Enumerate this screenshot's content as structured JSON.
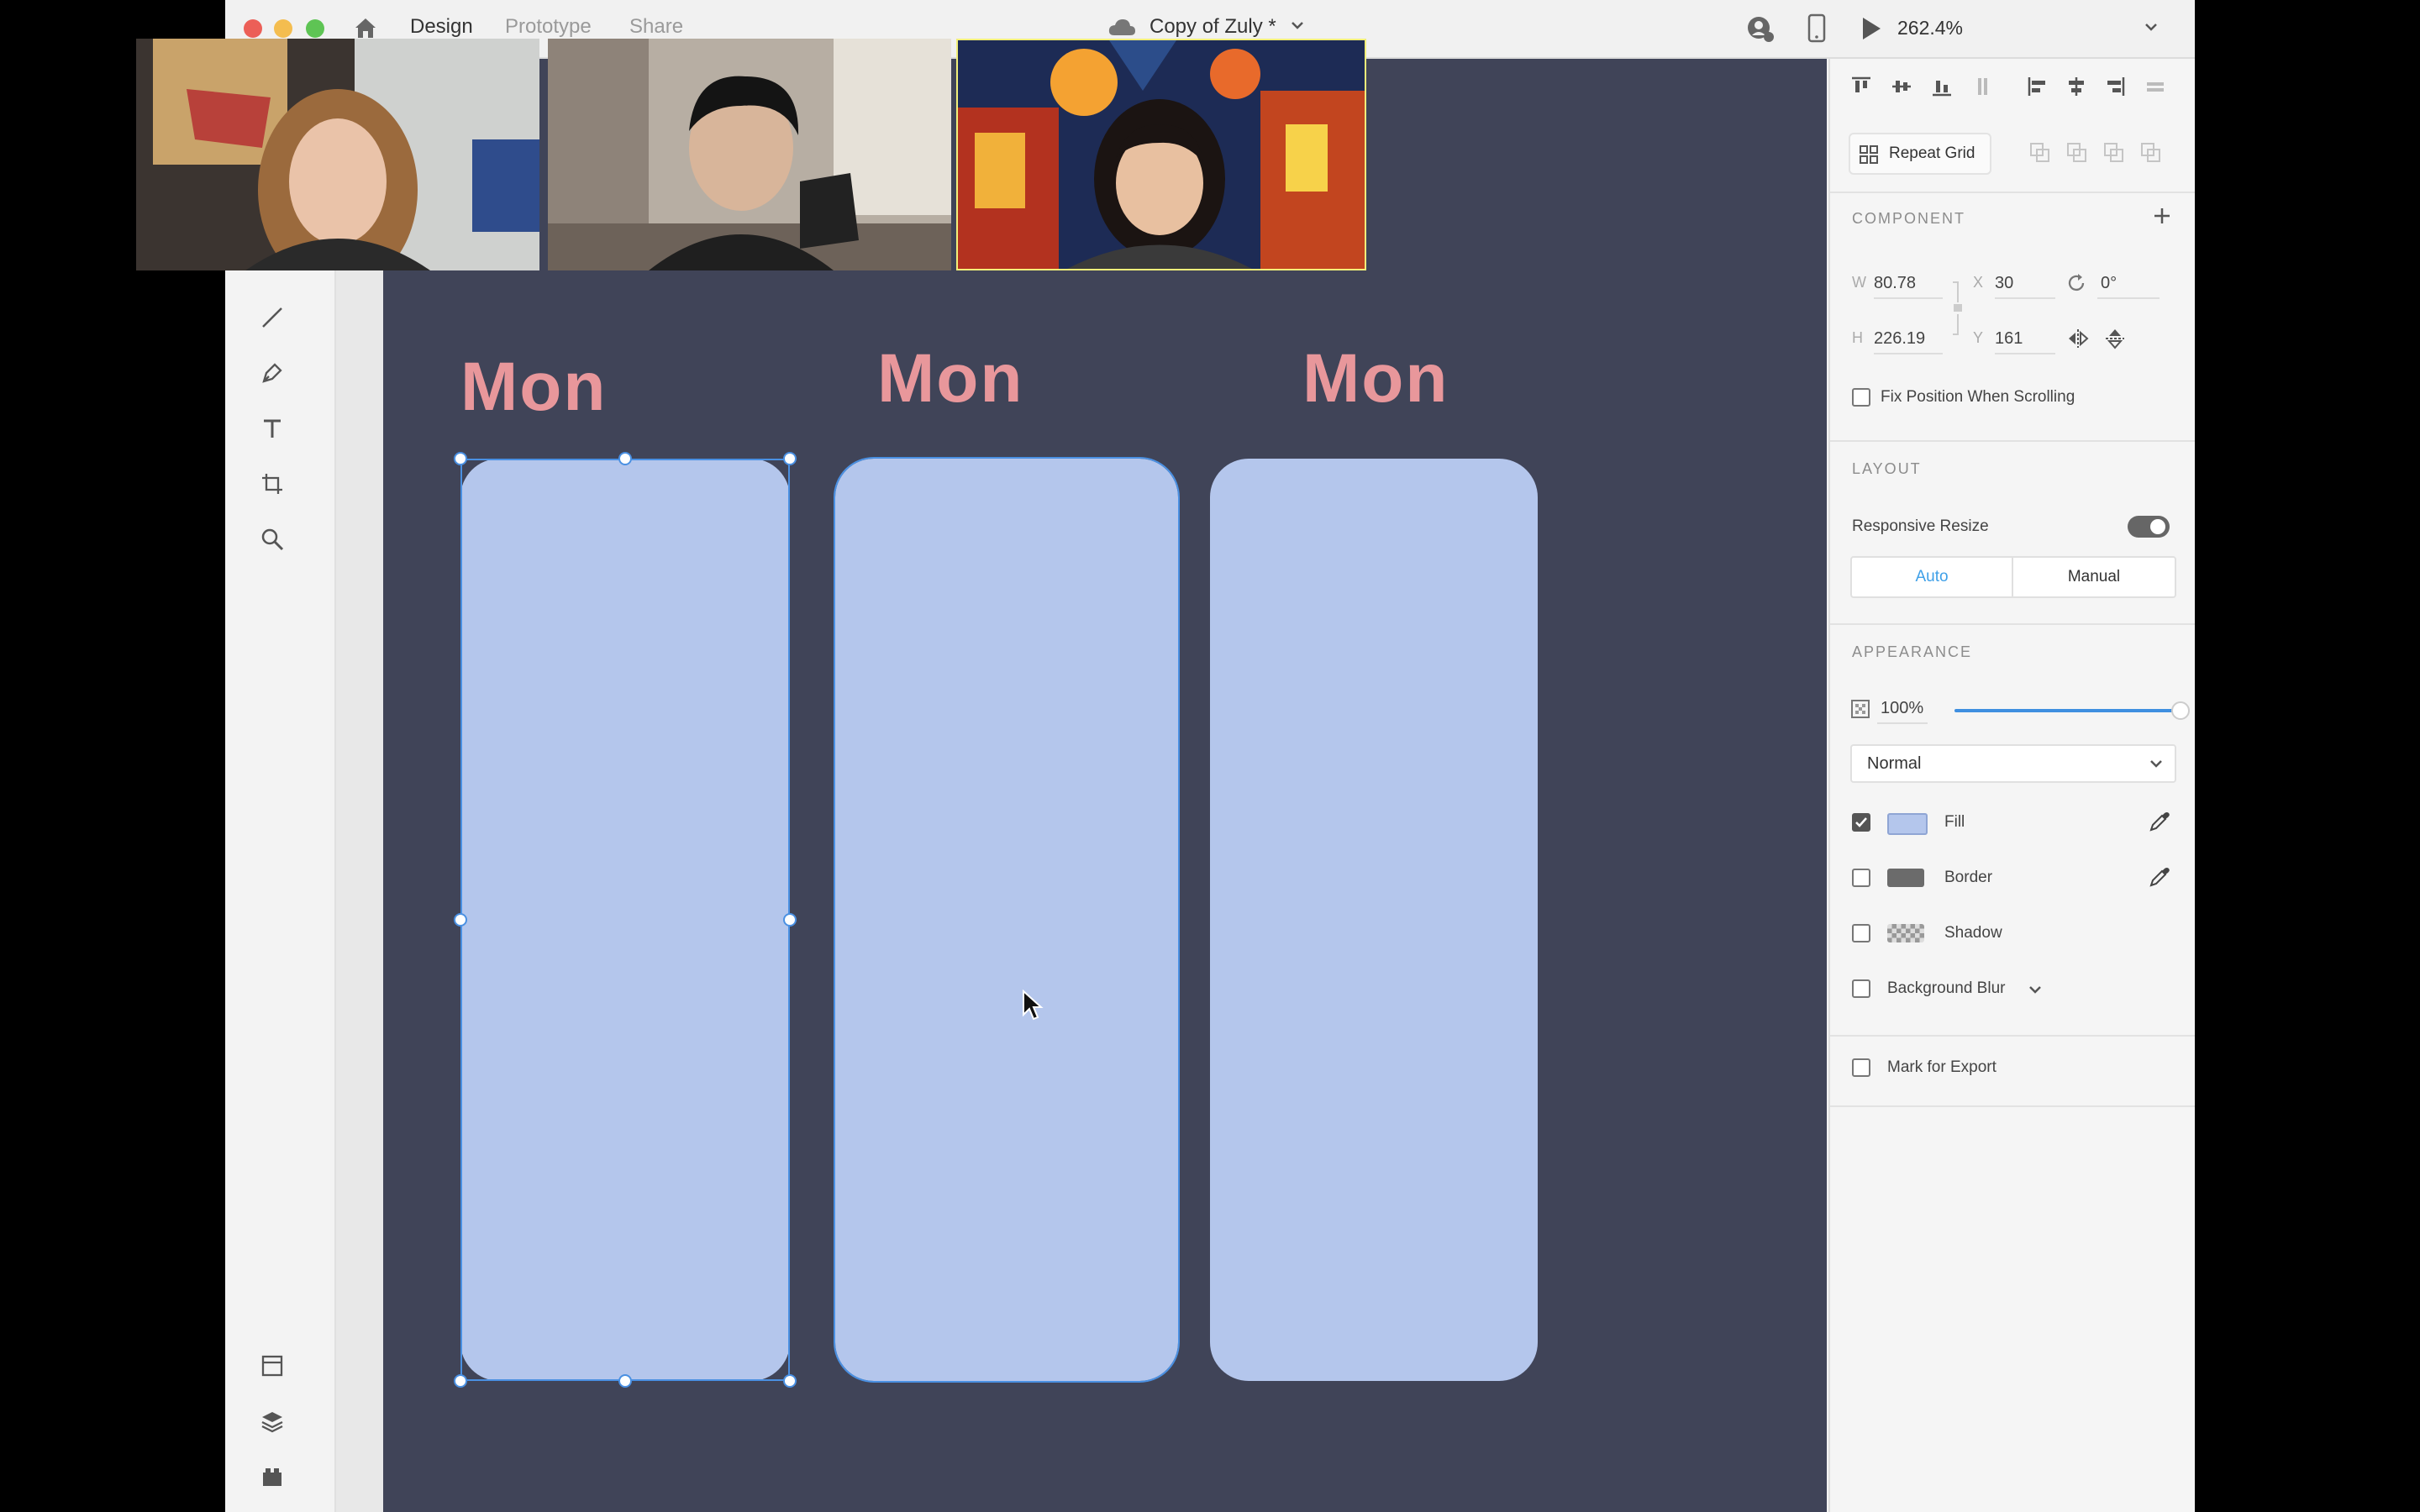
{
  "titlebar": {
    "nav_tabs": [
      "Design",
      "Prototype",
      "Share"
    ],
    "active_tab": "Design",
    "doc_title": "Copy of Zuly *",
    "zoom": "262.4%"
  },
  "canvas": {
    "day_labels": [
      "Mon",
      "Mon",
      "Mon"
    ],
    "card_fill": "#b4c6ec",
    "background": "#404458",
    "label_color": "#e8979b"
  },
  "panel": {
    "repeat_grid_label": "Repeat Grid",
    "component": {
      "heading": "COMPONENT"
    },
    "transform": {
      "w_label": "W",
      "w_value": "80.78",
      "x_label": "X",
      "x_value": "30",
      "rotation_value": "0°",
      "h_label": "H",
      "h_value": "226.19",
      "y_label": "Y",
      "y_value": "161"
    },
    "fix_position_label": "Fix Position When Scrolling",
    "layout": {
      "heading": "LAYOUT",
      "responsive_resize_label": "Responsive Resize",
      "responsive_resize_on": true,
      "auto_label": "Auto",
      "manual_label": "Manual"
    },
    "appearance": {
      "heading": "APPEARANCE",
      "opacity_value": "100%",
      "opacity_fraction": 1.0,
      "blend_mode": "Normal",
      "fill_label": "Fill",
      "fill_checked": true,
      "fill_color": "#b4c6ec",
      "border_label": "Border",
      "border_color": "#6b6b6b",
      "shadow_label": "Shadow",
      "background_blur_label": "Background Blur"
    },
    "mark_export_label": "Mark for Export"
  },
  "video_call": {
    "participants": 3,
    "active_speaker_index": 2
  }
}
